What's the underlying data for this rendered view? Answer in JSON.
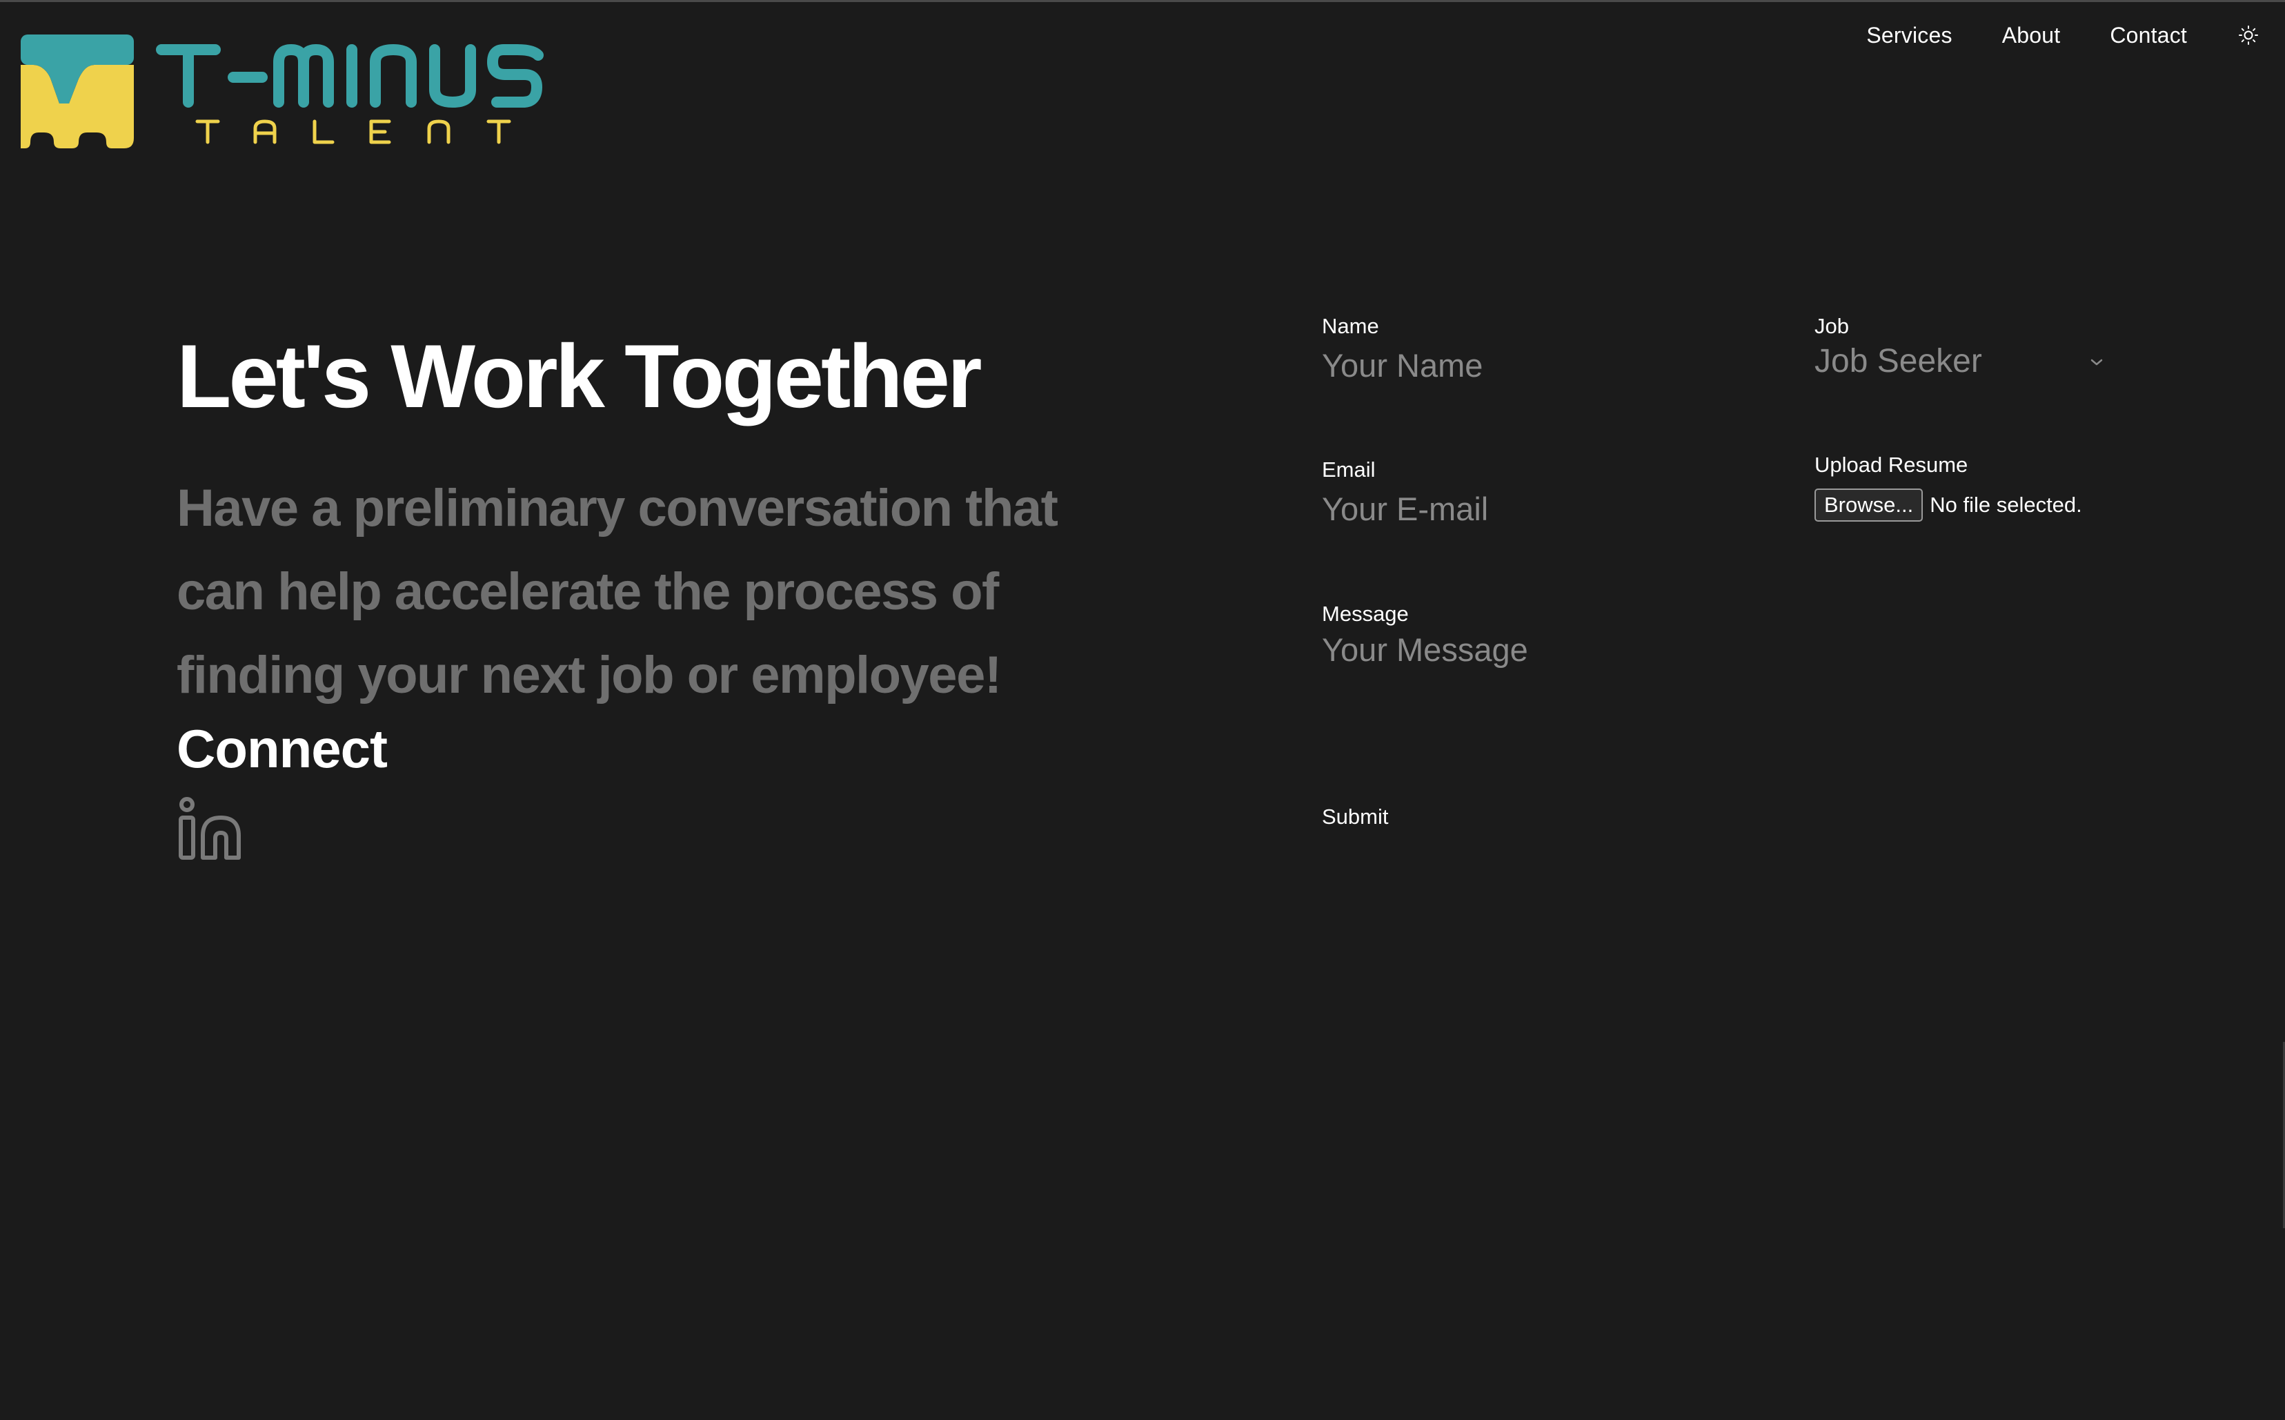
{
  "brand": {
    "name_main": "T-MINUS",
    "name_sub": "TALENT",
    "color_teal": "#3aa3a6",
    "color_yellow": "#efd24c"
  },
  "nav": {
    "items": [
      {
        "label": "Services"
      },
      {
        "label": "About"
      },
      {
        "label": "Contact"
      }
    ],
    "theme_toggle_icon": "sun-icon"
  },
  "hero": {
    "title": "Let's Work Together",
    "subtitle": "Have a preliminary conversation that can help accelerate the process of finding your next job or employee!",
    "connect_heading": "Connect",
    "social_icon": "linkedin-icon"
  },
  "form": {
    "name": {
      "label": "Name",
      "placeholder": "Your Name"
    },
    "email": {
      "label": "Email",
      "placeholder": "Your E-mail"
    },
    "message": {
      "label": "Message",
      "placeholder": "Your Message"
    },
    "job": {
      "label": "Job",
      "value": "Job Seeker"
    },
    "resume": {
      "label": "Upload Resume",
      "button": "Browse...",
      "status": "No file selected."
    },
    "submit": "Submit"
  }
}
